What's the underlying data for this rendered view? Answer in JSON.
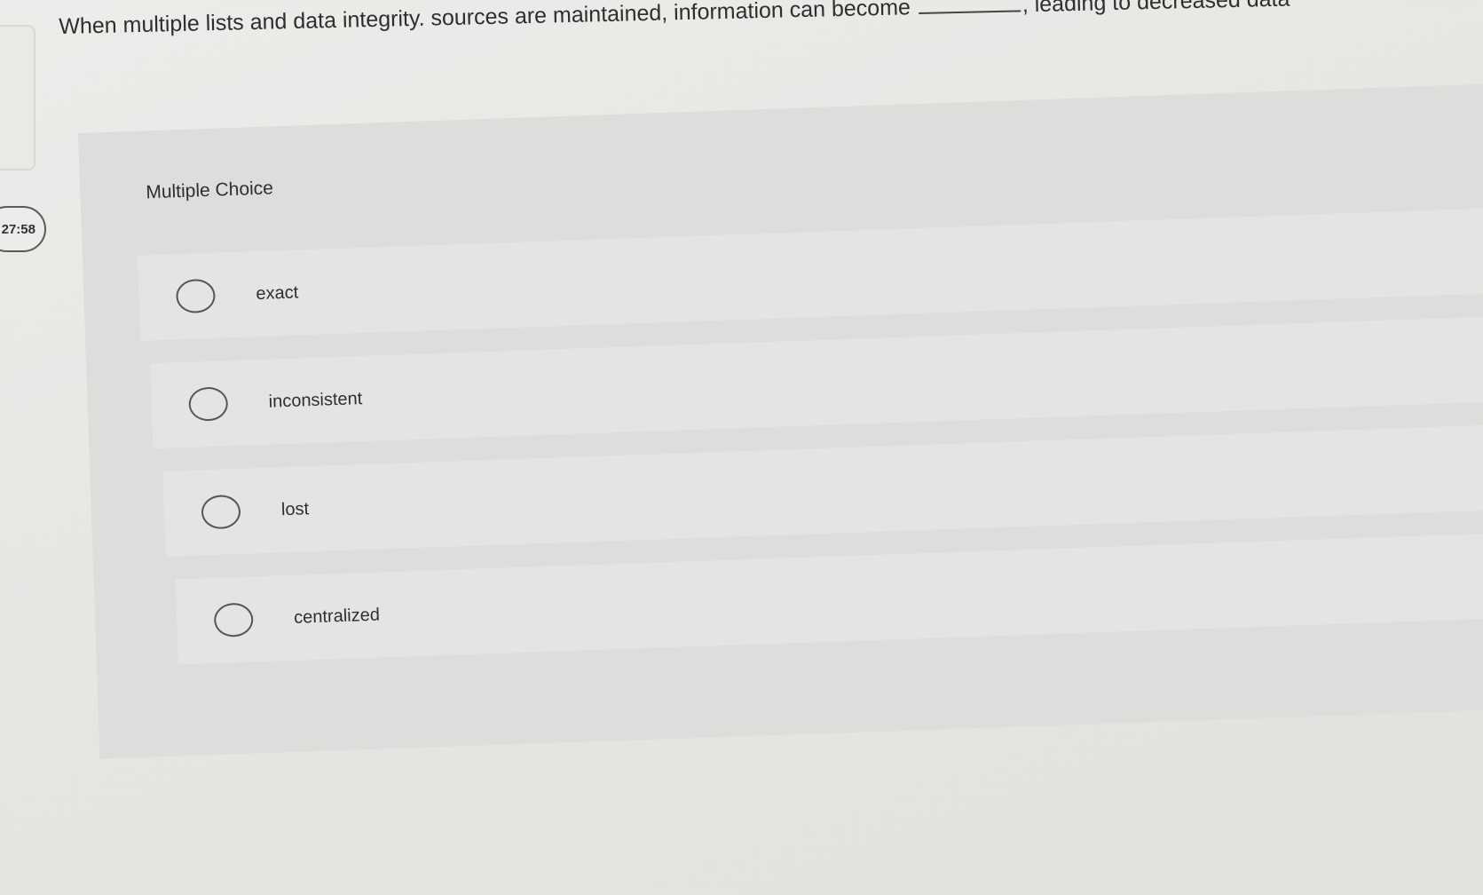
{
  "question": {
    "part1": "When multiple lists and data integrity. sources are maintained, information can become",
    "part2": ", leading to decreased data"
  },
  "timer": "27:58",
  "panel": {
    "title": "Multiple Choice",
    "options": [
      {
        "label": "exact"
      },
      {
        "label": "inconsistent"
      },
      {
        "label": "lost"
      },
      {
        "label": "centralized"
      }
    ]
  }
}
